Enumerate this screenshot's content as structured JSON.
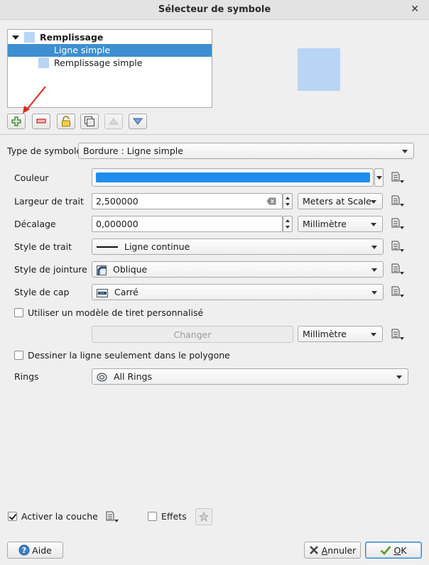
{
  "window": {
    "title": "Sélecteur de symbole",
    "close_glyph": "✕"
  },
  "layer_tree": {
    "root_label": "Remplissage",
    "items": [
      {
        "label": "Ligne simple",
        "selected": true
      },
      {
        "label": "Remplissage simple",
        "selected": false
      }
    ],
    "swatch_color": "#b9d5f5"
  },
  "preview": {
    "color": "#b9d5f5"
  },
  "toolbar": {
    "buttons": [
      {
        "name": "add-layer-button",
        "icon": "plus-icon"
      },
      {
        "name": "remove-layer-button",
        "icon": "minus-icon"
      },
      {
        "name": "lock-layer-button",
        "icon": "lock-icon"
      },
      {
        "name": "duplicate-layer-button",
        "icon": "duplicate-icon"
      },
      {
        "name": "move-up-button",
        "icon": "triangle-up-icon",
        "disabled": true
      },
      {
        "name": "move-down-button",
        "icon": "triangle-down-icon"
      }
    ]
  },
  "symbol_type": {
    "label": "Type de symbole",
    "value": "Bordure : Ligne simple"
  },
  "fields": {
    "color_label": "Couleur",
    "color_value": "#1f8ded",
    "width_label": "Largeur de trait",
    "width_value": "2,500000",
    "width_unit": "Meters at Scale",
    "offset_label": "Décalage",
    "offset_value": "0,000000",
    "offset_unit": "Millimètre",
    "pen_style_label": "Style de trait",
    "pen_style_value": "Ligne continue",
    "join_style_label": "Style de jointure",
    "join_style_value": "Oblique",
    "cap_style_label": "Style de cap",
    "cap_style_value": "Carré",
    "custom_dash_label": "Utiliser un modèle de tiret personnalisé",
    "custom_dash_checked": false,
    "change_button": "Changer",
    "dash_unit": "Millimètre",
    "draw_inside_label": "Dessiner la ligne seulement dans le polygone",
    "draw_inside_checked": false,
    "rings_label": "Rings",
    "rings_value": "All Rings"
  },
  "footer": {
    "enable_layer_label": "Activer la couche",
    "enable_layer_checked": true,
    "effects_label": "Effets",
    "effects_checked": false,
    "help_button": "Aide",
    "cancel_button": "Annuler",
    "cancel_mnemonic": "A",
    "cancel_rest": "nnuler",
    "ok_button": "OK",
    "ok_mnemonic": "O",
    "ok_rest": "K"
  },
  "colors": {
    "selection": "#3d8fd1",
    "accent_blue": "#1f8ded"
  }
}
